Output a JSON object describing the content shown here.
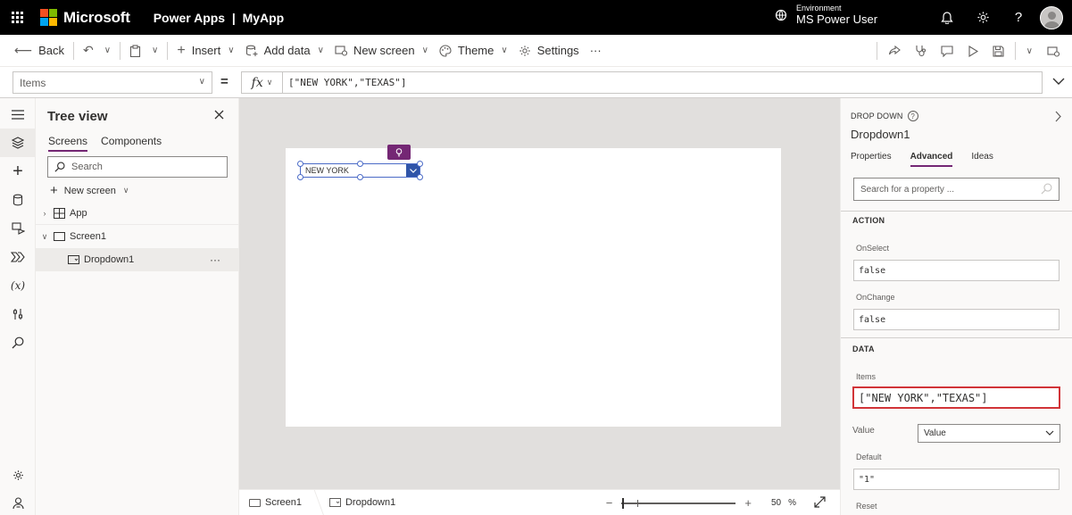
{
  "topbar": {
    "brand": "Microsoft",
    "app_title": "Power Apps  |  MyApp",
    "environment_label": "Environment",
    "environment_name": "MS Power User",
    "icons": [
      "waffle-icon",
      "environment-icon",
      "bell-icon",
      "gear-icon",
      "help-icon",
      "avatar"
    ],
    "logo_colors": [
      "#f25022",
      "#7fba00",
      "#00a4ef",
      "#ffb900"
    ]
  },
  "commandbar": {
    "back": "Back",
    "insert": "Insert",
    "add_data": "Add data",
    "new_screen": "New screen",
    "theme": "Theme",
    "settings": "Settings",
    "more": "···"
  },
  "formulabar": {
    "property": "Items",
    "equals": "=",
    "fx": "fx",
    "formula": "[\"NEW YORK\",\"TEXAS\"]"
  },
  "treeview": {
    "title": "Tree view",
    "tabs": [
      "Screens",
      "Components"
    ],
    "search_placeholder": "Search",
    "new_screen": "New screen",
    "nodes": {
      "app": "App",
      "screen": "Screen1",
      "dropdown": "Dropdown1"
    },
    "more": "···"
  },
  "canvas": {
    "dropdown_value": "NEW YORK"
  },
  "statusbar": {
    "screen": "Screen1",
    "control": "Dropdown1",
    "zoom_value": "50",
    "zoom_unit": "%",
    "zoom_percent": 50
  },
  "properties": {
    "control_type": "DROP DOWN",
    "control_name": "Dropdown1",
    "tabs": [
      "Properties",
      "Advanced",
      "Ideas"
    ],
    "active_tab": "Advanced",
    "search_placeholder": "Search for a property ...",
    "action_header": "ACTION",
    "onselect_label": "OnSelect",
    "onselect_value": "false",
    "onchange_label": "OnChange",
    "onchange_value": "false",
    "data_header": "DATA",
    "items_label": "Items",
    "items_value": "[\"NEW YORK\",\"TEXAS\"]",
    "value_label": "Value",
    "value_selected": "Value",
    "default_label": "Default",
    "default_value": "\"1\"",
    "reset_label": "Reset"
  },
  "colors": {
    "accent": "#742774",
    "topbar": "#000000",
    "selection": "#4b6bc7",
    "dropdown_button": "#2f54a8",
    "highlight_border": "#d13438"
  }
}
